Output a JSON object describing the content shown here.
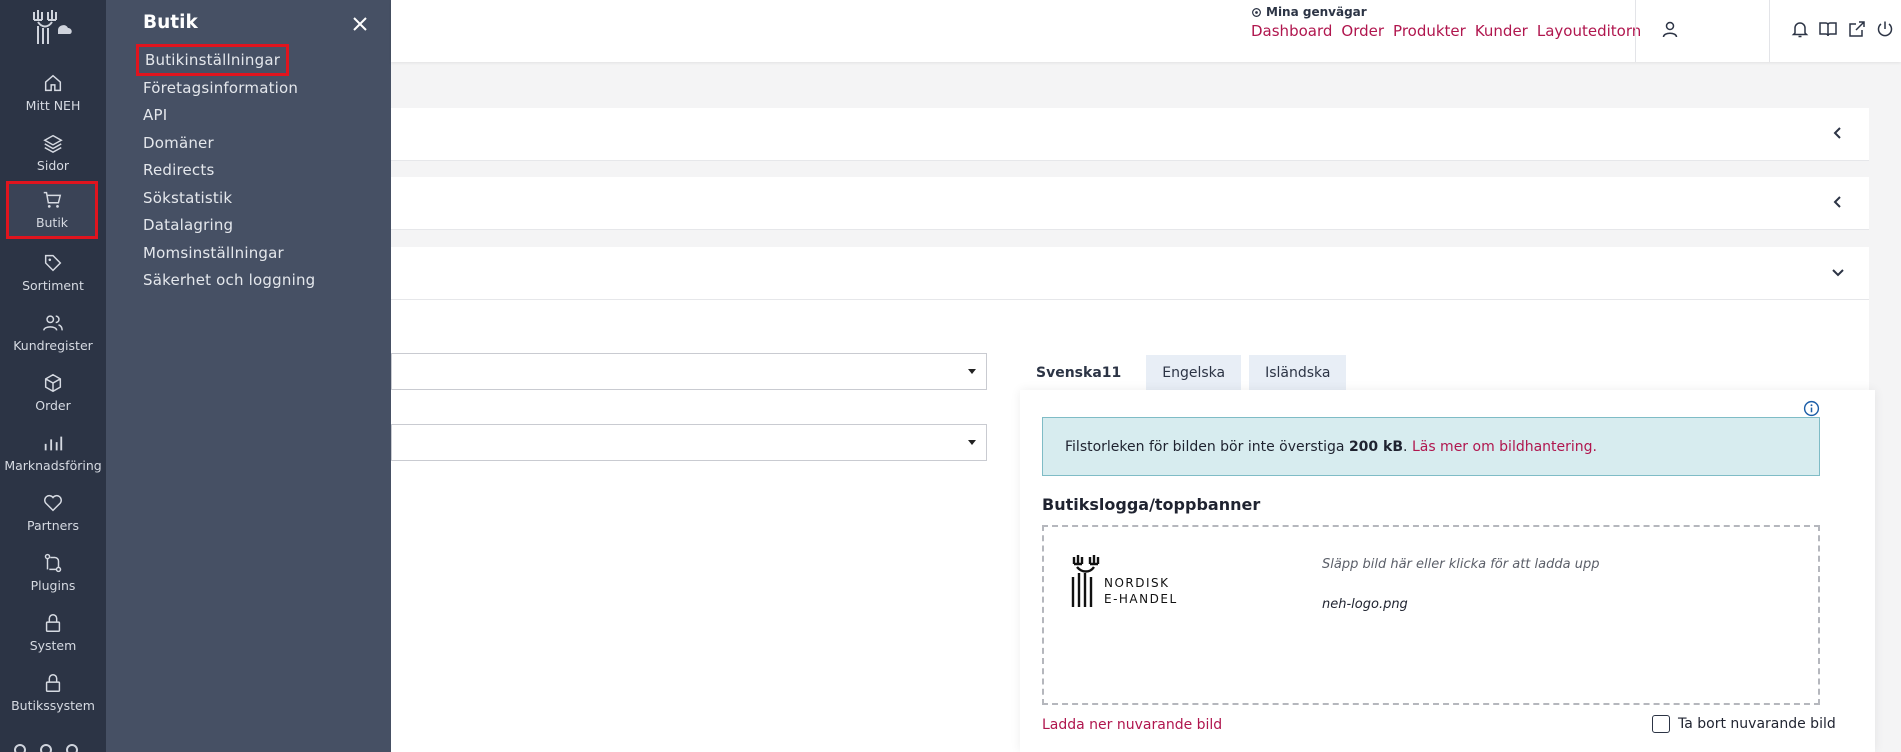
{
  "rail": {
    "items": [
      {
        "label": "Mitt NEH",
        "icon": "home-icon"
      },
      {
        "label": "Sidor",
        "icon": "layers-icon"
      },
      {
        "label": "Butik",
        "icon": "cart-icon"
      },
      {
        "label": "Sortiment",
        "icon": "tag-icon"
      },
      {
        "label": "Kundregister",
        "icon": "users-icon"
      },
      {
        "label": "Order",
        "icon": "box-icon"
      },
      {
        "label": "Marknadsföring",
        "icon": "bar-chart-icon"
      },
      {
        "label": "Partners",
        "icon": "heart-icon"
      },
      {
        "label": "Plugins",
        "icon": "plugin-icon"
      },
      {
        "label": "System",
        "icon": "lock-icon"
      },
      {
        "label": "Butikssystem",
        "icon": "lock-icon"
      }
    ],
    "active": "Butik"
  },
  "flyout": {
    "title": "Butik",
    "items": [
      {
        "label": "Butikinställningar"
      },
      {
        "label": "Företagsinformation"
      },
      {
        "label": "API"
      },
      {
        "label": "Domäner"
      },
      {
        "label": "Redirects"
      },
      {
        "label": "Sökstatistik"
      },
      {
        "label": "Datalagring"
      },
      {
        "label": "Momsinställningar"
      },
      {
        "label": "Säkerhet och loggning"
      }
    ],
    "selected": "Butikinställningar"
  },
  "header": {
    "shortcuts_title": "Mina genvägar",
    "shortcuts": [
      "Dashboard",
      "Order",
      "Produkter",
      "Kunder",
      "Layouteditorn"
    ]
  },
  "tabs": [
    {
      "label": "Svenska11",
      "active": true
    },
    {
      "label": "Engelska",
      "active": false
    },
    {
      "label": "Isländska",
      "active": false
    }
  ],
  "notice": {
    "text_before": "Filstorleken för bilden bör inte överstiga ",
    "size": "200 kB",
    "text_after": ". ",
    "link": "Läs mer om bildhantering."
  },
  "image_section": {
    "title": "Butikslogga/toppbanner",
    "dropzone_hint": "Släpp bild här eller klicka för att ladda upp",
    "filename": "neh-logo.png",
    "logo_text_1": "NORDISK",
    "logo_text_2": "E-HANDEL",
    "download_link": "Ladda ner nuvarande bild",
    "remove_label": "Ta bort nuvarande bild"
  },
  "colors": {
    "rail_bg": "#2c3445",
    "flyout_bg": "#465064",
    "link": "#b0164e",
    "highlight": "#e0141e",
    "notice_bg": "#d7ecef"
  }
}
